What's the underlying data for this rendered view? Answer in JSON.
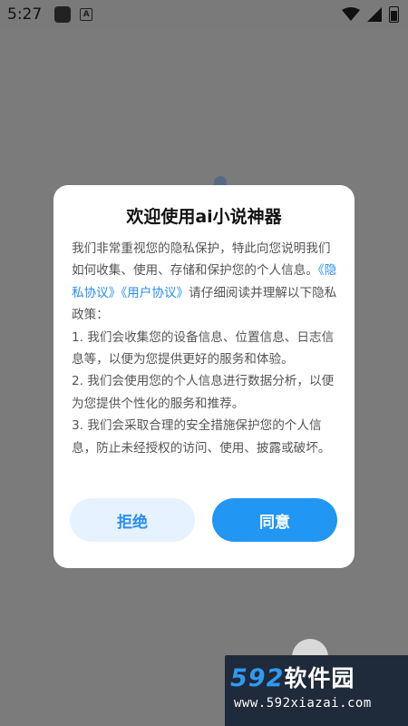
{
  "status_bar": {
    "time": "5:27",
    "icon_notice": "A"
  },
  "dialog": {
    "title": "欢迎使用ai小说神器",
    "intro_prefix": "我们非常重视您的隐私保护，特此向您说明我们如何收集、使用、存储和保护您的个人信息。",
    "privacy_link": "《隐私协议》",
    "user_link": "《用户协议》",
    "intro_suffix": "请仔细阅读并理解以下隐私政策：",
    "items": [
      "1. 我们会收集您的设备信息、位置信息、日志信息等，以便为您提供更好的服务和体验。",
      "2. 我们会使用您的个人信息进行数据分析，以便为您提供个性化的服务和推荐。",
      "3. 我们会采取合理的安全措施保护您的个人信息，防止未经授权的访问、使用、披露或破坏。"
    ],
    "reject_label": "拒绝",
    "agree_label": "同意"
  },
  "watermark": {
    "brand_number": "592",
    "brand_text": "软件园",
    "url": "www.592xiazai.com"
  },
  "colors": {
    "accent": "#2196f3",
    "link": "#2a8ef2",
    "overlay": "#7a7a7a"
  }
}
